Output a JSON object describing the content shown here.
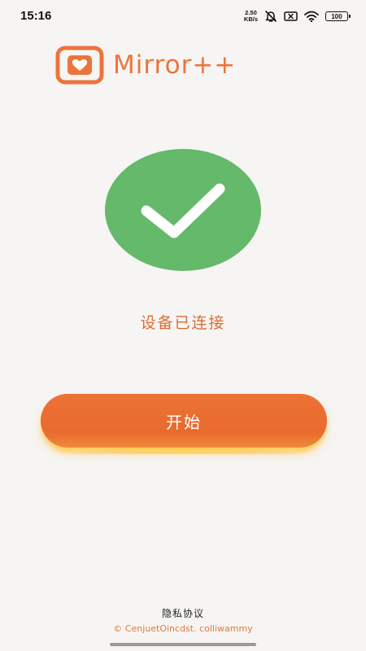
{
  "status_bar": {
    "time": "15:16",
    "net_speed_value": "2.50",
    "net_speed_unit": "KB/s",
    "battery": "100",
    "icons": [
      "mute-icon",
      "sim-off-icon",
      "wifi-icon",
      "battery-icon"
    ]
  },
  "brand": {
    "name": "Mirror++",
    "logo_icon": "heart-icon",
    "accent_color": "#ec743b"
  },
  "status": {
    "icon": "checkmark-icon",
    "icon_color": "#64b96a",
    "text": "设备已连接"
  },
  "start_button": {
    "label": "开始",
    "color": "#ea6c30"
  },
  "footer": {
    "privacy_label": "隐私协议",
    "copyright": "© CenjuetOincdst. colliwammy"
  }
}
